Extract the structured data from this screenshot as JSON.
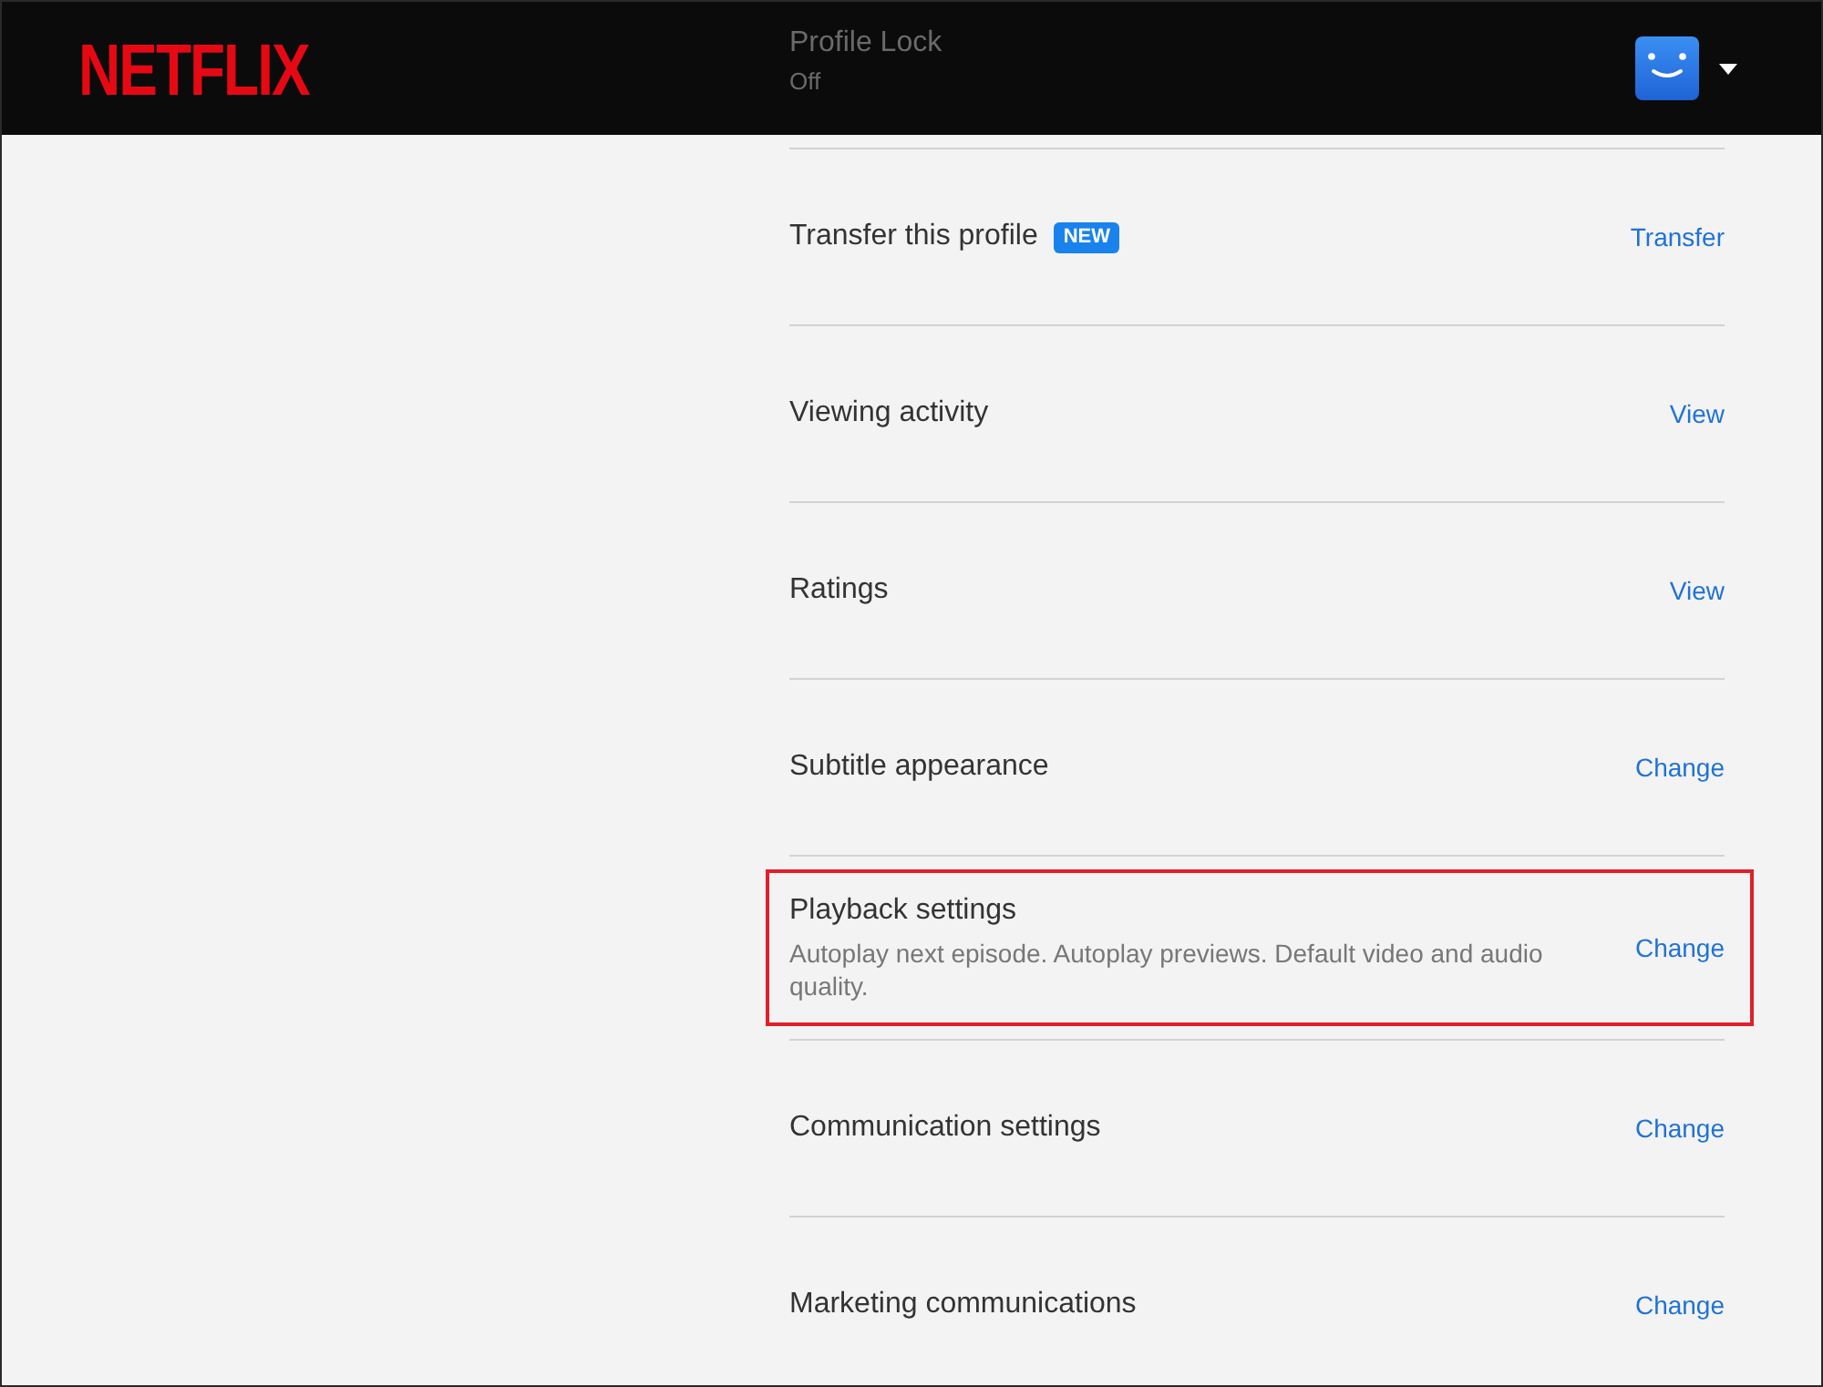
{
  "header": {
    "logo": "NETFLIX",
    "overlapped_row": {
      "title": "Profile Lock",
      "value": "Off"
    }
  },
  "rows": [
    {
      "title": "Transfer this profile",
      "badge": "NEW",
      "action": "Transfer",
      "highlighted": false
    },
    {
      "title": "Viewing activity",
      "action": "View",
      "highlighted": false
    },
    {
      "title": "Ratings",
      "action": "View",
      "highlighted": false
    },
    {
      "title": "Subtitle appearance",
      "action": "Change",
      "highlighted": false
    },
    {
      "title": "Playback settings",
      "description": "Autoplay next episode. Autoplay previews. Default video and audio quality.",
      "action": "Change",
      "highlighted": true
    },
    {
      "title": "Communication settings",
      "action": "Change",
      "highlighted": false
    },
    {
      "title": "Marketing communications",
      "action": "Change",
      "highlighted": false
    }
  ]
}
